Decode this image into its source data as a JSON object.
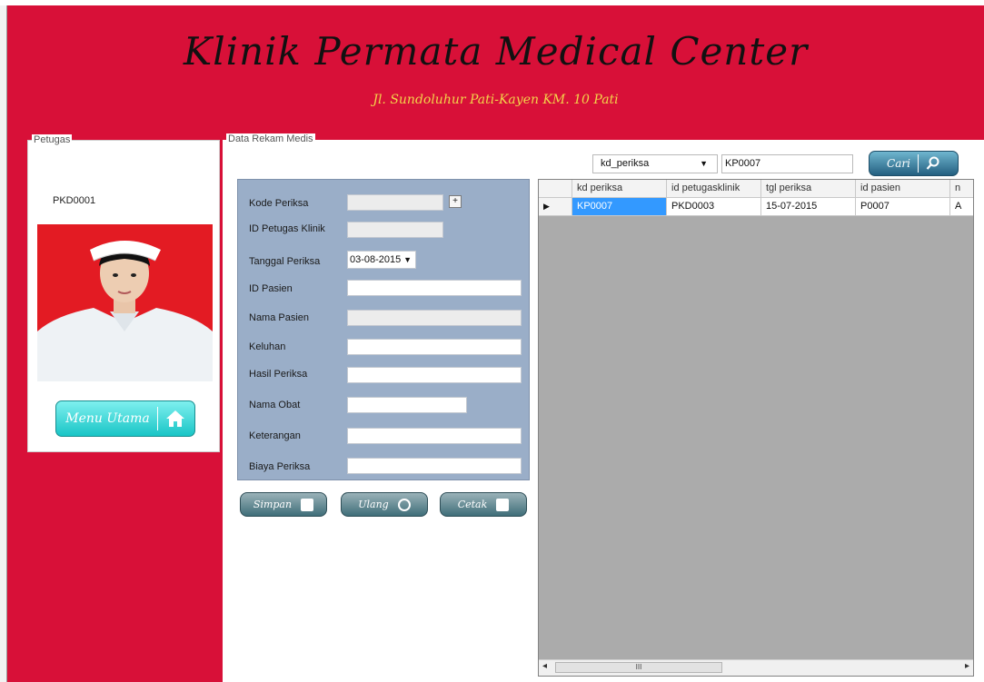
{
  "header": {
    "title": "Klinik Permata Medical Center",
    "subtitle": "Jl. Sundoluhur Pati-Kayen KM. 10 Pati"
  },
  "petugas": {
    "group_label": "Petugas",
    "id": "PKD0001",
    "menu_button": "Menu Utama"
  },
  "rekam": {
    "group_label": "Data Rekam Medis",
    "form": {
      "kode_periksa_label": "Kode Periksa",
      "id_petugas_label": "ID Petugas Klinik",
      "tanggal_label": "Tanggal Periksa",
      "tanggal_value": "03-08-2015",
      "id_pasien_label": "ID Pasien",
      "nama_pasien_label": "Nama Pasien",
      "keluhan_label": "Keluhan",
      "hasil_label": "Hasil Periksa",
      "obat_label": "Nama Obat",
      "keterangan_label": "Keterangan",
      "biaya_label": "Biaya Periksa",
      "plus": "+"
    },
    "buttons": {
      "simpan": "Simpan",
      "ulang": "Ulang",
      "cetak": "Cetak"
    },
    "search": {
      "field": "kd_periksa",
      "value": "KP0007",
      "cari": "Cari"
    },
    "grid": {
      "columns": [
        "kd periksa",
        "id petugasklinik",
        "tgl periksa",
        "id pasien",
        "n"
      ],
      "rows": [
        [
          "KP0007",
          "PKD0003",
          "15-07-2015",
          "P0007",
          "A"
        ]
      ],
      "scroll_label": "III"
    }
  }
}
